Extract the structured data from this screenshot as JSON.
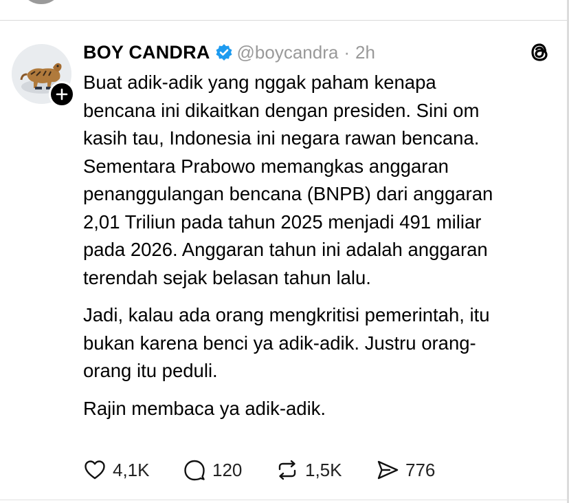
{
  "post": {
    "author": "BOY CANDRA",
    "handle": "@boycandra",
    "separator": "·",
    "time": "2h",
    "paragraphs": [
      "Buat adik-adik yang nggak paham kenapa\nbencana ini dikaitkan dengan presiden. Sini om\nkasih tau, Indonesia ini negara rawan bencana.\nSementara Prabowo memangkas anggaran\npenanggulangan bencana (BNPB) dari anggaran\n2,01 Triliun pada tahun 2025 menjadi 491 miliar\npada 2026. Anggaran tahun ini adalah anggaran\nterendah sejak belasan tahun lalu.",
      "Jadi, kalau ada orang mengkritisi pemerintah, itu\nbukan karena benci ya adik-adik. Justru orang-\norang itu peduli.",
      "Rajin membaca ya adik-adik."
    ]
  },
  "actions": {
    "likes": "4,1K",
    "replies": "120",
    "reposts": "1,5K",
    "shares": "776"
  },
  "icons": {
    "verified": "verified-badge-icon",
    "follow": "plus-icon",
    "app": "threads-logo-icon",
    "like": "heart-icon",
    "reply": "speech-bubble-icon",
    "repost": "repost-icon",
    "share": "send-icon"
  },
  "colors": {
    "verified": "#1d9bf0",
    "muted": "#999999",
    "text": "#000000"
  }
}
